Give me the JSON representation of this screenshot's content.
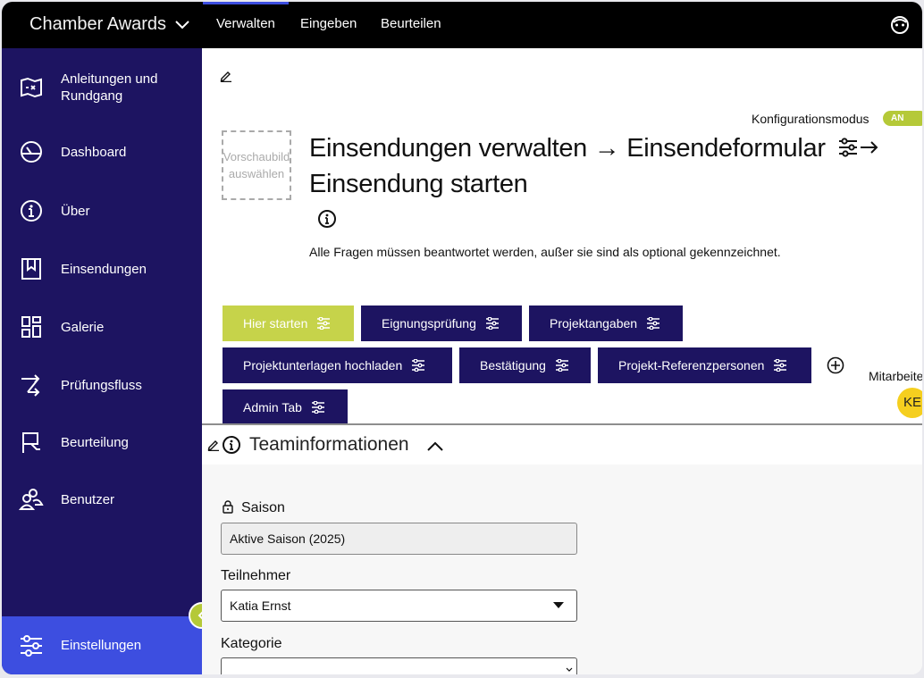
{
  "app": {
    "title": "Chamber Awards"
  },
  "topnav": {
    "tabs": [
      {
        "label": "Verwalten"
      },
      {
        "label": "Eingeben"
      },
      {
        "label": "Beurteilen"
      }
    ]
  },
  "sidebar": {
    "items": [
      {
        "label": "Anleitungen und Rundgang",
        "icon": "map-icon"
      },
      {
        "label": "Dashboard",
        "icon": "gauge-icon"
      },
      {
        "label": "Über",
        "icon": "info-icon"
      },
      {
        "label": "Einsendungen",
        "icon": "bookmark-icon"
      },
      {
        "label": "Galerie",
        "icon": "grid-icon"
      },
      {
        "label": "Prüfungsfluss",
        "icon": "flow-arrow-icon"
      },
      {
        "label": "Beurteilung",
        "icon": "flag-icon"
      },
      {
        "label": "Benutzer",
        "icon": "users-icon"
      }
    ],
    "settings": {
      "label": "Einstellungen",
      "icon": "sliders-icon"
    }
  },
  "main": {
    "config_mode": {
      "label": "Konfigurationsmodus",
      "state": "AN"
    },
    "preview": {
      "text": "Vorschaubild auswählen"
    },
    "title": "Einsendungen verwalten →  Einsendeformular",
    "title_line2": "Einsendung starten",
    "required_note": "Alle Fragen müssen beantwortet werden, außer sie sind als optional gekennzeichnet.",
    "tabs": [
      {
        "label": "Hier starten"
      },
      {
        "label": "Eignungsprüfung"
      },
      {
        "label": "Projektangaben"
      },
      {
        "label": "Projektunterlagen hochladen"
      },
      {
        "label": "Bestätigung"
      },
      {
        "label": "Projekt-Referenzpersonen"
      },
      {
        "label": "Admin Tab"
      }
    ],
    "collaborators": {
      "label": "Mitarbeiter",
      "avatar_initials": "KE"
    },
    "section": {
      "title": "Teaminformationen"
    },
    "fields": {
      "season": {
        "label": "Saison",
        "value": "Aktive Saison (2025)"
      },
      "participant": {
        "label": "Teilnehmer",
        "value": "Katia Ernst"
      },
      "category": {
        "label": "Kategorie",
        "value": ""
      }
    }
  },
  "colors": {
    "sidebar_bg": "#1d1461",
    "accent_blue": "#3d4ee0",
    "accent_green": "#c6d34a",
    "topbar_bg": "#000000"
  }
}
